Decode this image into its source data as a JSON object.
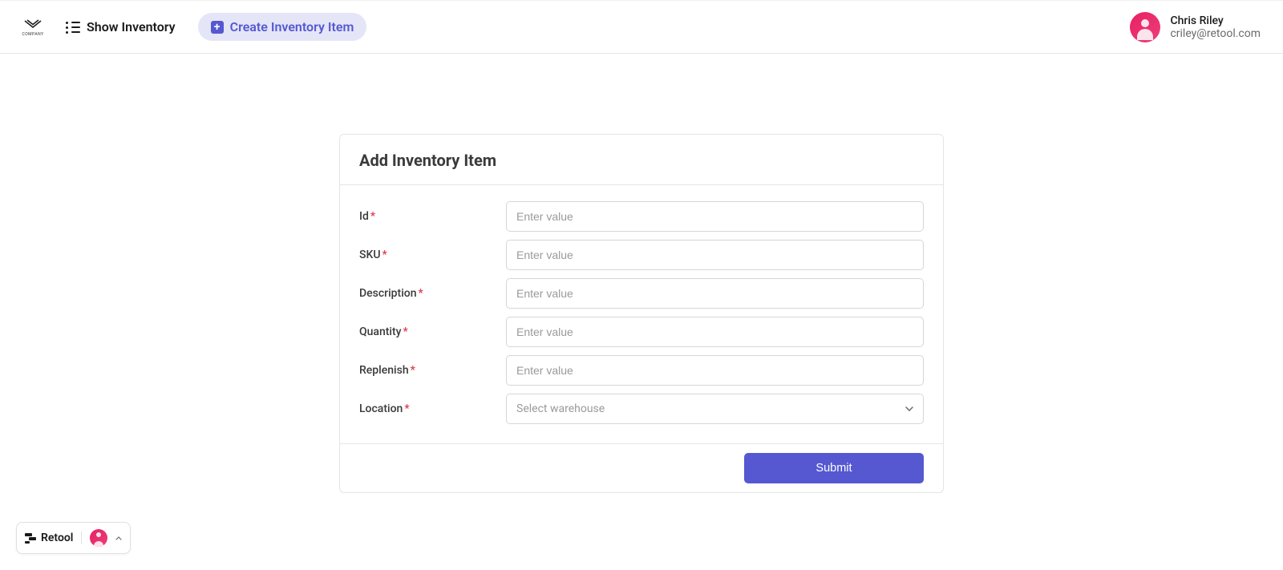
{
  "brand": {
    "logo_text": "COMPANY"
  },
  "nav": {
    "show_inventory_label": "Show Inventory",
    "create_item_label": "Create Inventory Item"
  },
  "user": {
    "name": "Chris Riley",
    "email": "criley@retool.com"
  },
  "form": {
    "title": "Add Inventory Item",
    "fields": {
      "id": {
        "label": "Id",
        "placeholder": "Enter value",
        "required": true
      },
      "sku": {
        "label": "SKU",
        "placeholder": "Enter value",
        "required": true
      },
      "description": {
        "label": "Description",
        "placeholder": "Enter value",
        "required": true
      },
      "quantity": {
        "label": "Quantity",
        "placeholder": "Enter value",
        "required": true
      },
      "replenish": {
        "label": "Replenish",
        "placeholder": "Enter value",
        "required": true
      },
      "location": {
        "label": "Location",
        "placeholder": "Select warehouse",
        "required": true
      }
    },
    "submit_label": "Submit"
  },
  "floating": {
    "brand_label": "Retool"
  }
}
